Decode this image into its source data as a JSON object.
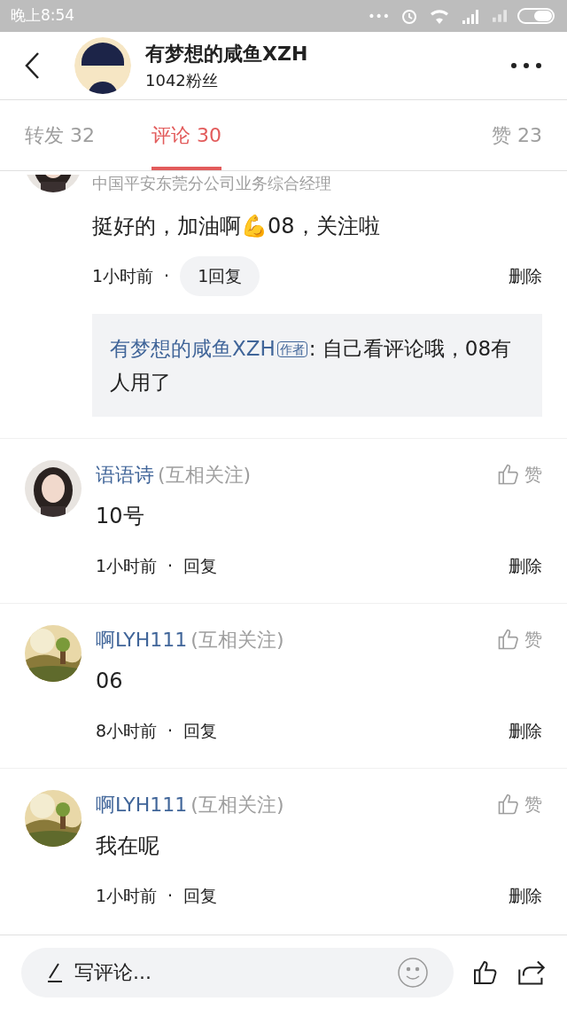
{
  "status_bar": {
    "time": "晚上8:54",
    "dots": "•••"
  },
  "header": {
    "name": "有梦想的咸鱼XZH",
    "followers": "1042粉丝"
  },
  "tabs": [
    {
      "label": "转发 32",
      "selected": false
    },
    {
      "label": "评论 30",
      "selected": true
    },
    {
      "label": "赞 23",
      "selected": false
    }
  ],
  "comments": [
    {
      "kind": "cut",
      "subtitle": "中国平安东莞分公司业务综合经理",
      "text": "挺好的，加油啊💪08，关注啦",
      "time": "1小时前",
      "dot": "·",
      "reply": {
        "label": "1回复",
        "boxed": true
      },
      "delete": "删除",
      "replies": [
        {
          "author": "有梦想的咸鱼XZH",
          "badge": "作者",
          "text": ": 自己看评论哦，08有人用了"
        }
      ]
    },
    {
      "kind": "full",
      "name": "语语诗",
      "relation": "(互相关注)",
      "like": "赞",
      "text": "10号",
      "time": "1小时前",
      "dot": "·",
      "reply": {
        "label": "回复",
        "boxed": false
      },
      "delete": "删除"
    },
    {
      "kind": "full",
      "name": "啊LYH111",
      "relation": "(互相关注)",
      "like": "赞",
      "text": "06",
      "time": "8小时前",
      "dot": "·",
      "reply": {
        "label": "回复",
        "boxed": false
      },
      "delete": "删除"
    },
    {
      "kind": "full",
      "name": "啊LYH111",
      "relation": "(互相关注)",
      "like": "赞",
      "text": "我在呢",
      "time": "1小时前",
      "dot": "·",
      "reply": {
        "label": "回复",
        "boxed": false
      },
      "delete": "删除"
    }
  ],
  "bottom_bar": {
    "placeholder": "写评论..."
  }
}
